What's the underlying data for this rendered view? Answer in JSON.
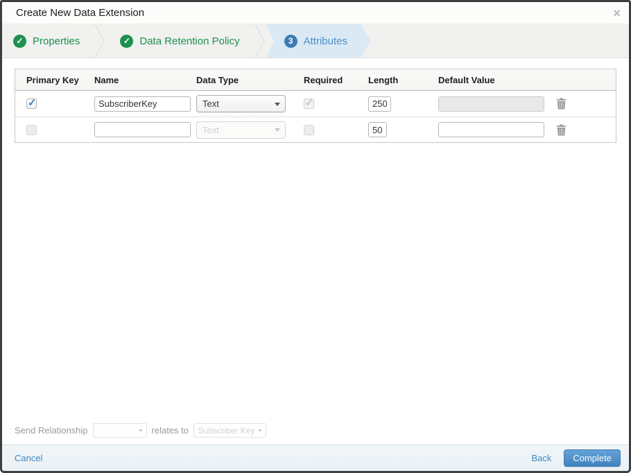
{
  "dialog": {
    "title": "Create New Data Extension"
  },
  "icons": {
    "close": "×",
    "check": "✓"
  },
  "steps": [
    {
      "label": "Properties",
      "state": "complete"
    },
    {
      "label": "Data Retention Policy",
      "state": "complete"
    },
    {
      "label": "Attributes",
      "state": "active",
      "number": "3"
    }
  ],
  "table": {
    "headers": [
      "Primary Key",
      "Name",
      "Data Type",
      "Required",
      "Length",
      "Default Value"
    ],
    "rows": [
      {
        "primary_key_checked": "true",
        "name": "SubscriberKey",
        "data_type": "Text",
        "required_checked": "true",
        "required_disabled": "true",
        "length": "250",
        "default_value": "",
        "default_disabled": "true"
      },
      {
        "primary_key_checked": "false",
        "name": "",
        "data_type": "Text",
        "data_type_disabled": "true",
        "required_checked": "false",
        "length": "50",
        "default_value": "",
        "default_disabled": "false"
      }
    ]
  },
  "relationship": {
    "label": "Send Relationship",
    "source_value": "",
    "relates_label": "relates to",
    "target_value": "Subscriber Key"
  },
  "footer": {
    "cancel_label": "Cancel",
    "back_label": "Back",
    "complete_label": "Complete"
  },
  "colors": {
    "step_complete_green": "#1d9150",
    "step_active_blue": "#4a8fc7",
    "step_active_bg": "#dbe9f5",
    "link_blue": "#3d87c3",
    "primary_button_blue": "#4a90cd",
    "dialog_border": "#3e3e3e"
  }
}
